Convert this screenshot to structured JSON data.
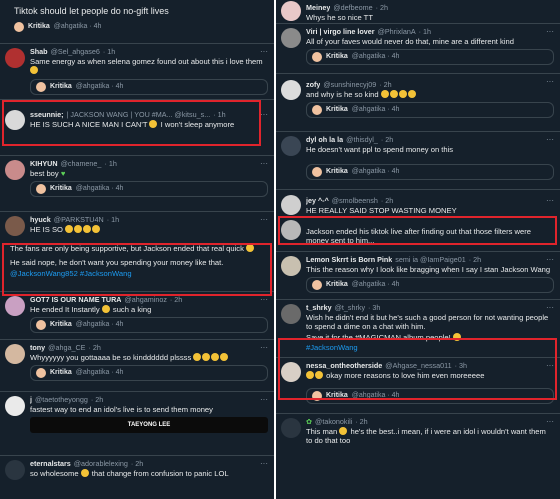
{
  "left": [
    {
      "id": "L0",
      "name": "",
      "handle": "",
      "time": "",
      "text": "Tiktok should let people do no-gift lives",
      "quote": {
        "name": "Kritika",
        "handle": "@ahgatika · 4h"
      }
    },
    {
      "id": "L1",
      "name": "Shab",
      "handle": "@Sel_ahgase6",
      "time": "· 1h",
      "text": "Same energy as when selena gomez found out about this i love them",
      "emoji_count": 1,
      "quote": {
        "name": "Kritika",
        "handle": "@ahgatika · 4h"
      }
    },
    {
      "id": "L2",
      "name": "sseunnie;",
      "handle": "| JACKSON WANG | YOU #MA... @kitsu_s...",
      "time": "· 1h",
      "text": "HE IS SUCH A NICE MAN I CAN'T",
      "text2": "I won't sleep anymore",
      "emoji_count": 1
    },
    {
      "id": "L3",
      "name": "KIHYUN",
      "handle": "@chamene_",
      "time": "· 1h",
      "text": "best boy",
      "heart": true,
      "quote": {
        "name": "Kritika",
        "handle": "@ahgatika · 4h"
      }
    },
    {
      "id": "L4",
      "name": "hyuck",
      "handle": "@PARKSTU4N",
      "time": "· 1h",
      "text": "HE IS SO",
      "emoji_count": 4
    },
    {
      "id": "L5",
      "name": "",
      "handle": "",
      "time": "",
      "text": "The fans are only being supportive, but Jackson ended that real quick",
      "text2": "He said nope, he don't want you spending your money like that.",
      "link": "@JacksonWang852 #JacksonWang",
      "emoji_count": 1
    },
    {
      "id": "L6",
      "name": "GOT7 IS OUR NAME TURA",
      "handle": "@ahgaminoz",
      "time": "· 2h",
      "text": "He ended It Instantly",
      "text2": "such a king",
      "emoji_count": 1,
      "quote": {
        "name": "Kritika",
        "handle": "@ahgatika · 4h"
      }
    },
    {
      "id": "L7",
      "name": "tony",
      "handle": "@ahga_CE",
      "time": "· 2h",
      "text": "Whyyyyyy you gottaaaa be so kindddddd plssss",
      "emoji_count": 4,
      "quote": {
        "name": "Kritika",
        "handle": "@ahgatika · 4h"
      }
    },
    {
      "id": "L8",
      "name": "j",
      "handle": "@taetotheyongg",
      "time": "· 2h",
      "text": "fastest way to end an idol's live is to send them money",
      "video": "TAEYONG LEE"
    },
    {
      "id": "L9",
      "name": "eternalstars",
      "handle": "@adorablelexing",
      "time": "· 2h",
      "text": "so wholesome",
      "text2": "that change from confusion to panic LOL",
      "emoji_count": 1
    }
  ],
  "right": [
    {
      "id": "R0",
      "name": "Meiney",
      "handle": "@defbeome",
      "time": "· 2h",
      "text": "Whys he so nice TT"
    },
    {
      "id": "R1",
      "name": "Viri | virgo line lover",
      "handle": "@PhrixlanA",
      "time": "· 1h",
      "text": "All of your faves would never do that, mine are a different kind",
      "quote": {
        "name": "Kritika",
        "handle": "@ahgatika · 4h"
      }
    },
    {
      "id": "R2",
      "name": "zofy",
      "handle": "@sunshinecyj09",
      "time": "· 2h",
      "text": "and why is he so kind",
      "emoji_count": 4,
      "quote": {
        "name": "Kritika",
        "handle": "@ahgatika · 4h"
      }
    },
    {
      "id": "R3",
      "name": "dyl oh la la",
      "handle": "@thisdyl_",
      "time": "· 2h",
      "text": "He doesn't want ppl to spend money on this",
      "quote": {
        "name": "Kritika",
        "handle": "@ahgatika · 4h"
      }
    },
    {
      "id": "R4",
      "name": "jey ^-^",
      "handle": "@smolbeensh",
      "time": "· 2h",
      "text": "HE REALLY SAID STOP WASTING MONEY"
    },
    {
      "id": "R5",
      "name": "",
      "handle": "",
      "time": "",
      "text": "Jackson ended his tiktok live after finding out that those filters were money sent to him..."
    },
    {
      "id": "R6",
      "name": "Lemon Skrrt is Born Pink",
      "handle": "semi ia @IamPaige01",
      "time": "· 2h",
      "text": "This the reason why I look like bragging when I say I stan Jackson Wang",
      "quote": {
        "name": "Kritika",
        "handle": "@ahgatika · 4h"
      }
    },
    {
      "id": "R7",
      "name": "t_shrky",
      "handle": "@t_shrky",
      "time": "· 3h",
      "text": "Wish he didn't end it but he's such a good person for not wanting people to spend a dime on a chat with him.",
      "text2": "Save it for the #MAGICMAN album people!",
      "link": "#JacksonWang",
      "emoji_count": 1
    },
    {
      "id": "R8",
      "name": "nessa_ontheotherside",
      "handle": "@Ahgase_nessa011",
      "time": "· 3h",
      "text": "okay more reasons to love him even moreeeee",
      "emoji_count": 2,
      "quote": {
        "name": "Kritika",
        "handle": "@ahgatika · 4h"
      }
    },
    {
      "id": "R9",
      "name": "",
      "handle": "@takonokili",
      "time": "· 2h",
      "text": "This man",
      "text2": "he's the best..i mean, if i were an idol i wouldn't want them to do that too",
      "emoji_count": 1
    }
  ],
  "colors": {
    "bg": "#15202b",
    "accent": "#1d9bf0",
    "highlight": "#e0242c"
  }
}
